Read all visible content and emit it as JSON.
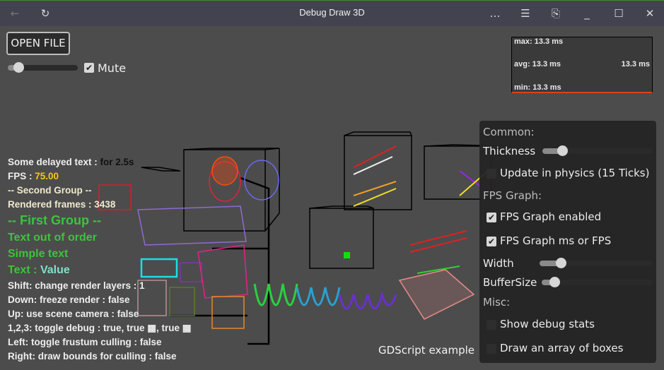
{
  "window": {
    "title": "Debug Draw 3D",
    "icons": [
      "back-arrow-icon",
      "reload-icon",
      "more-icon",
      "menu-icon",
      "screenshot-icon",
      "minimize-icon",
      "maximize-icon",
      "close-icon"
    ],
    "glyphs": {
      "back": "←",
      "reload": "↻",
      "more": "…",
      "menu": "☰",
      "screenshot": "⎘",
      "minimize": "_",
      "maximize": "☐",
      "close": "✕"
    }
  },
  "top_controls": {
    "open_file_label": "OPEN FILE",
    "volume_slider_value": 0.15,
    "mute_label": "Mute",
    "mute_checked": true
  },
  "fps_graph": {
    "max": "max: 13.3 ms",
    "avg": "avg: 13.3 ms",
    "current": "13.3 ms",
    "min": "min: 13.3 ms",
    "line_color": "#e0401a"
  },
  "debug_text": {
    "delayed_label": "Some delayed text : ",
    "delayed_value": "for 2.5s",
    "fps_label": "FPS : ",
    "fps_value": "75.00",
    "second_group": "-- Second Group --",
    "rendered_frames": "Rendered frames : 3438",
    "first_group": "-- First Group --",
    "out_of_order": "Text out of order",
    "simple_text": "Simple text",
    "text_label": "Text : ",
    "text_value": "Value",
    "shift": "Shift: change render layers : 1",
    "down": "Down: freeze render : false",
    "up": "Up: use scene camera : false",
    "toggle_debug": "1,2,3: toggle debug : true, true ▦, true ▦",
    "left": "Left: toggle frustum culling : false",
    "right": "Right: draw bounds for culling : false",
    "colors": {
      "fps_value": "#f5c518",
      "green": "#3cc43c",
      "value": "#7fe0c8",
      "cream": "#efe9cf"
    }
  },
  "scene_label": "GDScript example",
  "settings_panel": {
    "common_header": "Common:",
    "thickness_label": "Thickness",
    "thickness_value": 0.18,
    "update_physics_label": "Update in physics (15 Ticks)",
    "update_physics_checked": false,
    "fps_graph_header": "FPS Graph:",
    "fps_graph_enabled_label": "FPS Graph enabled",
    "fps_graph_enabled_checked": true,
    "fps_graph_ms_label": "FPS Graph ms or FPS",
    "fps_graph_ms_checked": true,
    "width_label": "Width",
    "width_value": 0.19,
    "buffer_label": "BufferSize",
    "buffer_value": 0.1,
    "misc_header": "Misc:",
    "show_debug_stats_label": "Show debug stats",
    "show_debug_stats_checked": false,
    "draw_boxes_label": "Draw an array of boxes",
    "draw_boxes_checked": false
  }
}
